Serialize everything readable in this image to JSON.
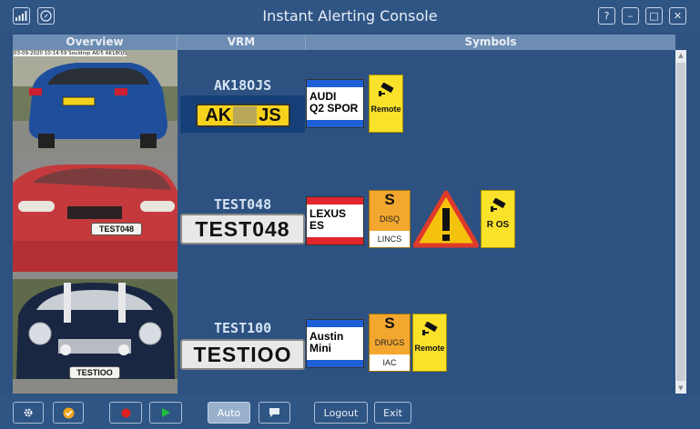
{
  "window": {
    "title": "Instant Alerting Console",
    "controls": [
      "?",
      "–",
      "□",
      "✕"
    ]
  },
  "columns": [
    "Overview",
    "VRM",
    "Symbols"
  ],
  "rows": [
    {
      "timestamp": "03-09-2020 10:14:59 Souldrop A6/5 AK18OJS",
      "vrm": "AK18OJS",
      "plate_text": "AK",
      "plate_text_end": "JS",
      "make": "AUDI\nQ2 SPOR",
      "make_bar_color": "#1f5fd6",
      "symbols": [
        {
          "type": "camera",
          "label": "Remote"
        }
      ]
    },
    {
      "vrm": "TEST048",
      "photo_plate": "TEST048",
      "plate_text": "TEST048",
      "make": "LEXUS\nES",
      "make_bar_color": "#e0262c",
      "symbols": [
        {
          "type": "status",
          "letter": "S",
          "middle": "DISQ",
          "bottom": "LINCS"
        },
        {
          "type": "warning"
        },
        {
          "type": "camera",
          "label": "R OS"
        }
      ]
    },
    {
      "vrm": "TEST100",
      "photo_plate": "TESTIOO",
      "plate_text": "TESTIOO",
      "make": "Austin\nMini",
      "make_bar_color": "#1f5fd6",
      "symbols": [
        {
          "type": "status",
          "letter": "S",
          "middle": "DRUGS",
          "bottom": "IAC"
        },
        {
          "type": "camera",
          "label": "Remote"
        }
      ]
    }
  ],
  "bottombar": {
    "auto_label": "Auto",
    "logout_label": "Logout",
    "exit_label": "Exit"
  }
}
